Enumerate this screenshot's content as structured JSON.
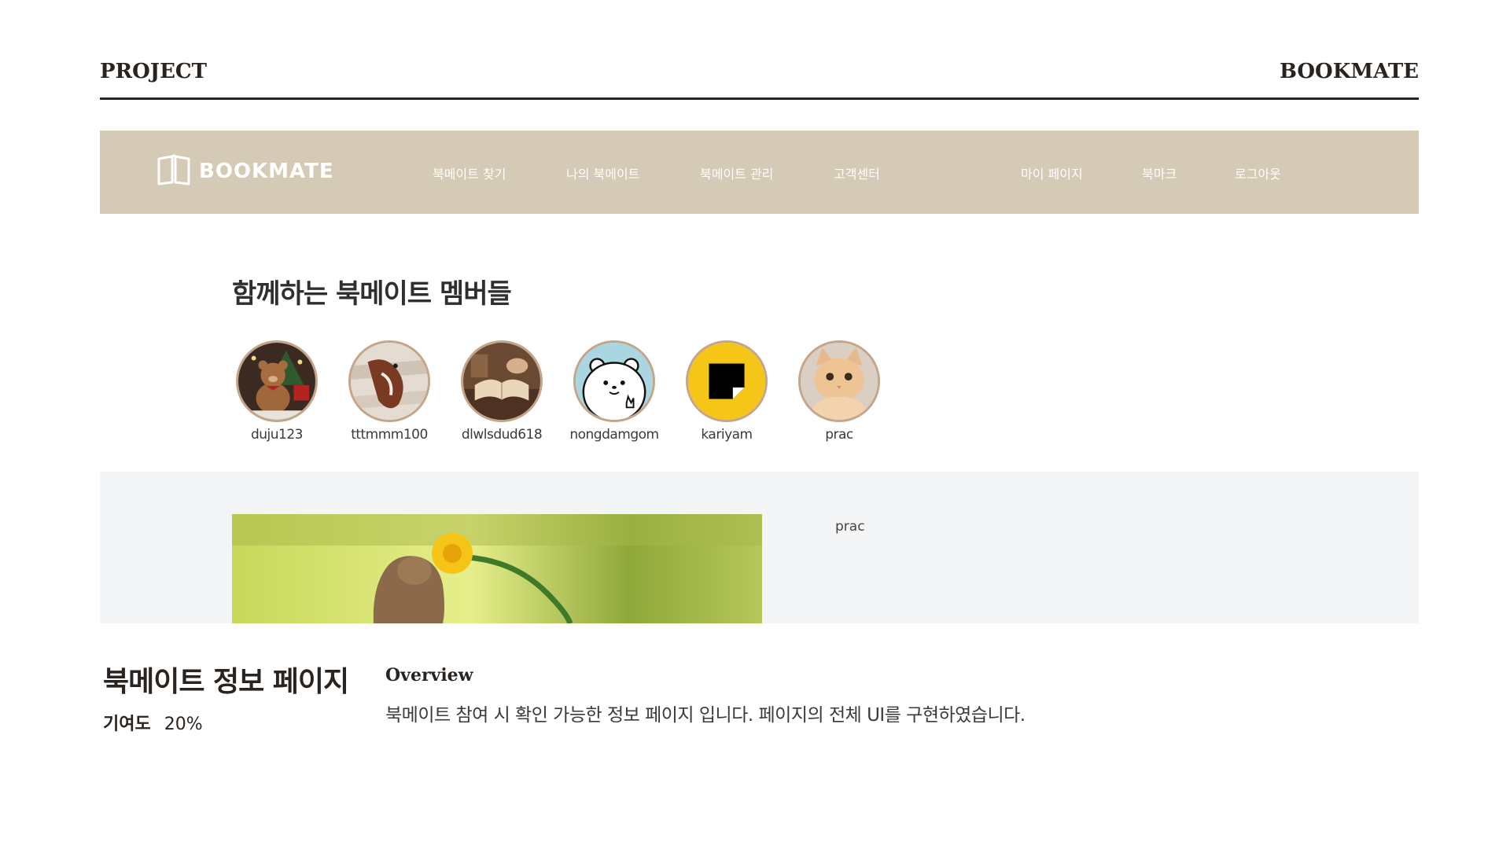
{
  "header": {
    "left": "PROJECT",
    "right": "BOOKMATE"
  },
  "nav": {
    "logo": "BOOKMATE",
    "items": [
      "북메이트 찾기",
      "나의 북메이트",
      "북메이트 관리",
      "고객센터"
    ],
    "user_items": [
      "마이 페이지",
      "북마크",
      "로그아웃"
    ]
  },
  "members": {
    "title": "함께하는 북메이트 멤버들",
    "list": [
      {
        "name": "duju123",
        "icon": "teddy-bear-avatar"
      },
      {
        "name": "tttmmm100",
        "icon": "bird-painting-avatar"
      },
      {
        "name": "dlwlsdud618",
        "icon": "open-book-avatar"
      },
      {
        "name": "nongdamgom",
        "icon": "white-bear-avatar"
      },
      {
        "name": "kariyam",
        "icon": "yellow-note-avatar"
      },
      {
        "name": "prac",
        "icon": "cat-avatar"
      }
    ]
  },
  "detail": {
    "name": "prac",
    "image": "squirrel-flower-photo"
  },
  "caption": {
    "title": "북메이트 정보 페이지",
    "contribution_label": "기여도",
    "contribution_value": "20%",
    "overview_label": "Overview",
    "overview_text": "북메이트 참여 시 확인 가능한 정보 페이지 입니다.  페이지의 전체 UI를 구현하였습니다."
  },
  "colors": {
    "nav_bg": "#d5cab5",
    "detail_bg": "#f4f5f7",
    "header_rule": "#2a2420"
  }
}
